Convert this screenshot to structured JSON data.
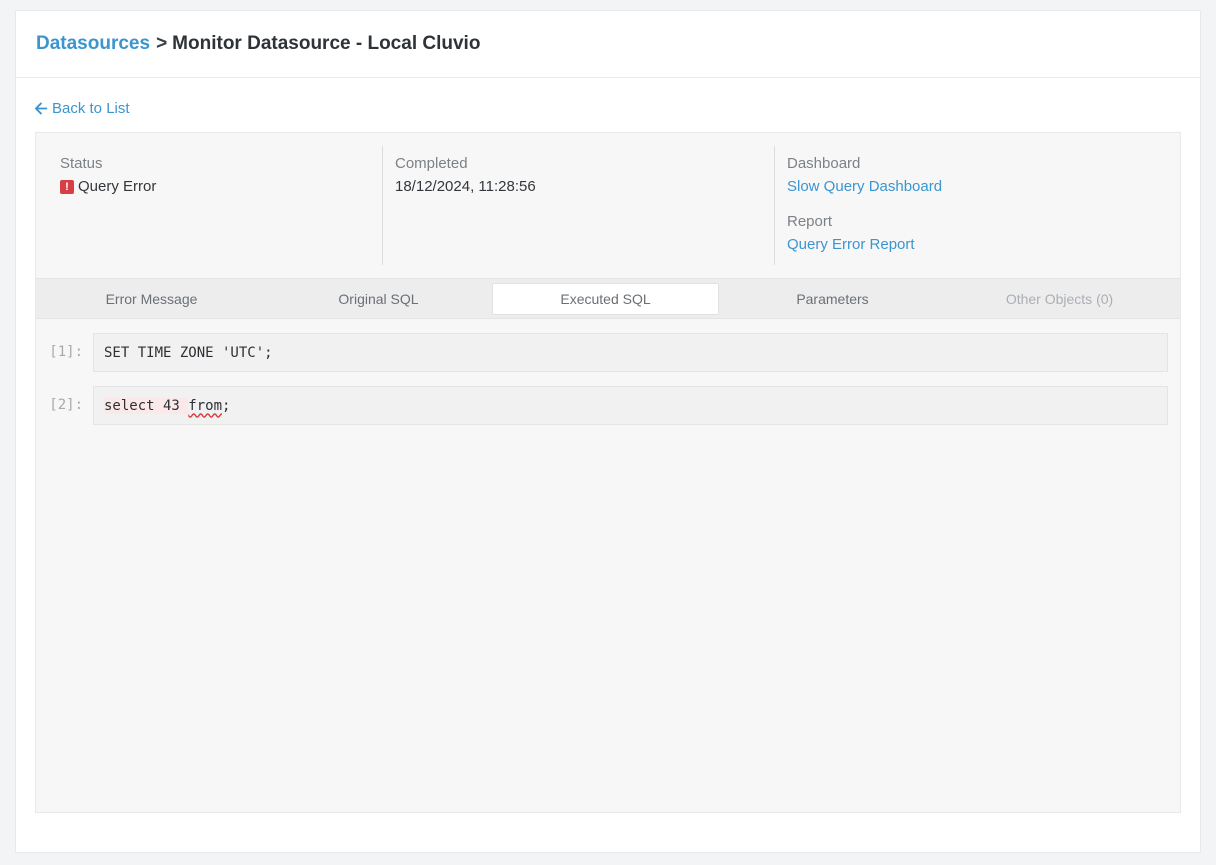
{
  "breadcrumb": {
    "root": "Datasources",
    "separator": ">",
    "current": "Monitor Datasource - Local Cluvio"
  },
  "back_link": "Back to List",
  "info": {
    "status_label": "Status",
    "status_value": "Query Error",
    "completed_label": "Completed",
    "completed_value": "18/12/2024, 11:28:56",
    "dashboard_label": "Dashboard",
    "dashboard_link": "Slow Query Dashboard",
    "report_label": "Report",
    "report_link": "Query Error Report"
  },
  "tabs": [
    {
      "label": "Error Message",
      "active": false
    },
    {
      "label": "Original SQL",
      "active": false
    },
    {
      "label": "Executed SQL",
      "active": true
    },
    {
      "label": "Parameters",
      "active": false
    },
    {
      "label": "Other Objects (0)",
      "active": false,
      "disabled": true
    }
  ],
  "statements": [
    {
      "number": "[1]:",
      "code": "SET TIME ZONE 'UTC';"
    },
    {
      "number": "[2]:",
      "code_prefix": "select 43 ",
      "code_error": "from",
      "code_suffix": ";"
    }
  ],
  "colors": {
    "link": "#3b95cf",
    "error": "#d64045"
  }
}
